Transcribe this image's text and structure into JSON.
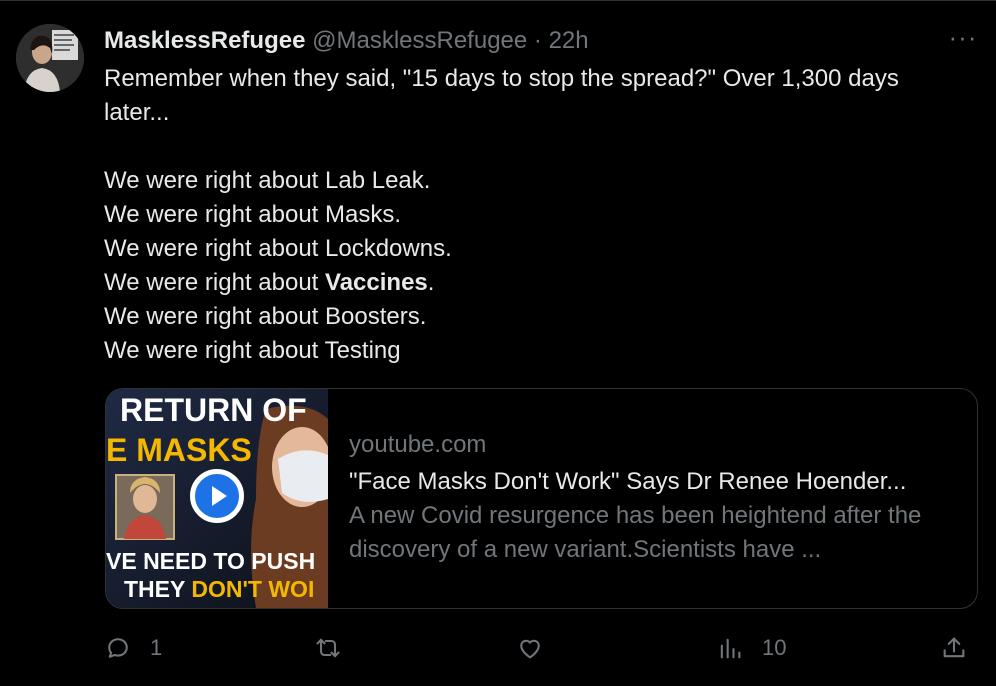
{
  "tweet": {
    "display_name": "MasklessRefugee",
    "handle": "@MasklessRefugee",
    "separator": "·",
    "time": "22h",
    "more_label": "···",
    "line1": "Remember when they said, \"15 days to stop the spread?\" Over 1,300 days later...",
    "right_lines": [
      "We were right about Lab Leak.",
      "We were right about Masks.",
      "We were right about Lockdowns."
    ],
    "vaccines_prefix": "We were right about ",
    "vaccines_word": "Vaccines",
    "vaccines_suffix": ".",
    "boosters_line": "We were right about Boosters.",
    "testing_line": "We were right about Testing"
  },
  "card": {
    "domain": "youtube.com",
    "title": "\"Face Masks Don't Work\" Says Dr Renee Hoender...",
    "description": "A new Covid resurgence has been heightend after the discovery of a new variant.Scientists have ...",
    "thumb_line1": "RETURN OF",
    "thumb_line2": "E MASKS",
    "thumb_line3": "VE NEED TO PUSH",
    "thumb_line4_a": "THEY ",
    "thumb_line4_b": "DON'T WOI",
    "accent_color": "#f5b800",
    "play_color": "#1d72e8"
  },
  "actions": {
    "reply_count": "1",
    "retweet_count": "",
    "like_count": "",
    "views_count": "10"
  },
  "icons": [
    "reply-icon",
    "retweet-icon",
    "like-icon",
    "views-icon",
    "share-icon",
    "more-icon",
    "play-icon"
  ]
}
